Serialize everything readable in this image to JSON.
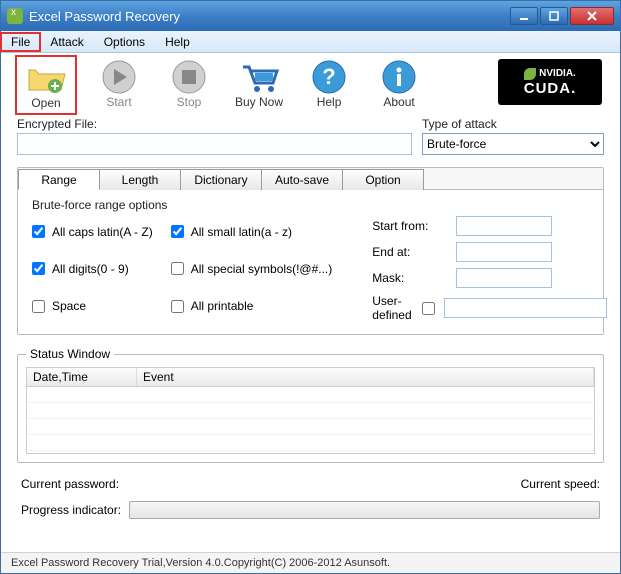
{
  "window": {
    "title": "Excel Password Recovery"
  },
  "menu": {
    "file": "File",
    "attack": "Attack",
    "options": "Options",
    "help": "Help"
  },
  "toolbar": {
    "open": "Open",
    "start": "Start",
    "stop": "Stop",
    "buy": "Buy Now",
    "help": "Help",
    "about": "About"
  },
  "cuda": {
    "brand": "NVIDIA.",
    "label": "CUDA."
  },
  "encrypted": {
    "label": "Encrypted File:",
    "value": ""
  },
  "attack_type": {
    "label": "Type of attack",
    "value": "Brute-force"
  },
  "tabs": {
    "range": "Range",
    "length": "Length",
    "dictionary": "Dictionary",
    "autosave": "Auto-save",
    "option": "Option"
  },
  "range_opts": {
    "legend": "Brute-force range options",
    "allcaps": "All caps latin(A - Z)",
    "allsmall": "All small latin(a - z)",
    "alldigits": "All digits(0 - 9)",
    "allspecial": "All special symbols(!@#...)",
    "space": "Space",
    "printable": "All printable",
    "startfrom_lbl": "Start from:",
    "endat_lbl": "End at:",
    "mask_lbl": "Mask:",
    "userdef_lbl": "User-defined",
    "startfrom": "",
    "endat": "",
    "mask": "",
    "userdef": ""
  },
  "status": {
    "legend": "Status Window",
    "col_date": "Date,Time",
    "col_event": "Event"
  },
  "footer": {
    "curpwd_lbl": "Current password:",
    "curspeed_lbl": "Current speed:",
    "progress_lbl": "Progress indicator:"
  },
  "statusbar": "Excel Password Recovery Trial,Version 4.0.Copyright(C) 2006-2012 Asunsoft."
}
